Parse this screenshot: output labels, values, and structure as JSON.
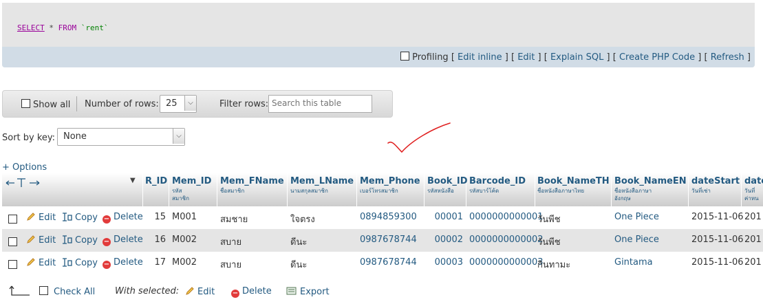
{
  "sql": {
    "select": "SELECT",
    "star": " * ",
    "from": "FROM",
    "table": " `rent`"
  },
  "toolbar": {
    "profiling": "Profiling",
    "edit_inline": "Edit inline",
    "edit": "Edit",
    "explain_sql": "Explain SQL",
    "create_php_code": "Create PHP Code",
    "refresh": "Refresh"
  },
  "nav": {
    "show_all": "Show all",
    "number_of_rows_label": "Number of rows:",
    "number_of_rows_value": "25",
    "filter_rows_label": "Filter rows:",
    "search_placeholder": "Search this table"
  },
  "sort": {
    "label": "Sort by key:",
    "value": "None"
  },
  "options_label": "+ Options",
  "columns": [
    {
      "name": "R_ID",
      "sub": ""
    },
    {
      "name": "Mem_ID",
      "sub": "รหัส\nสมาชิก"
    },
    {
      "name": "Mem_FName",
      "sub": "ชื่อสมาชิก"
    },
    {
      "name": "Mem_LName",
      "sub": "นามสกุลสมาชิก"
    },
    {
      "name": "Mem_Phone",
      "sub": "เบอร์โทรสมาชิก"
    },
    {
      "name": "Book_ID",
      "sub": "รหัสหนังสือ"
    },
    {
      "name": "Barcode_ID",
      "sub": "รหัสบาร์โค้ด"
    },
    {
      "name": "Book_NameTH",
      "sub": "ชื่อหนังสือภาษาไทย"
    },
    {
      "name": "Book_NameEN",
      "sub": "ชื่อหนังสือภาษา\nอังกฤษ"
    },
    {
      "name": "dateStart",
      "sub": "วันที่เช่า"
    },
    {
      "name": "date",
      "sub": "วันที่\nค่าหน"
    }
  ],
  "row_actions": {
    "edit": "Edit",
    "copy": "Copy",
    "delete": "Delete"
  },
  "rows": [
    {
      "r_id": "15",
      "mem_id": "M001",
      "fname": "สมชาย",
      "lname": "ใจตรง",
      "phone": "0894859300",
      "book_id": "00001",
      "barcode": "0000000000001",
      "name_th": "วันพีช",
      "name_en": "One Piece",
      "date_start": "2015-11-06",
      "date_end": "201"
    },
    {
      "r_id": "16",
      "mem_id": "M002",
      "fname": "สบาย",
      "lname": "ดีนะ",
      "phone": "0987678744",
      "book_id": "00002",
      "barcode": "0000000000002",
      "name_th": "วันพีช",
      "name_en": "One Piece",
      "date_start": "2015-11-06",
      "date_end": "201"
    },
    {
      "r_id": "17",
      "mem_id": "M002",
      "fname": "สบาย",
      "lname": "ดีนะ",
      "phone": "0987678744",
      "book_id": "00003",
      "barcode": "0000000000003",
      "name_th": "กินทามะ",
      "name_en": "Gintama",
      "date_start": "2015-11-06",
      "date_end": "201"
    }
  ],
  "footer": {
    "check_all": "Check All",
    "with_selected": "With selected:",
    "edit": "Edit",
    "delete": "Delete",
    "export": "Export"
  },
  "colors": {
    "link": "#235a81",
    "toolbar_bg": "#d1dce6",
    "sql_bg": "#e5e5e5",
    "annotation": "#e02020"
  }
}
